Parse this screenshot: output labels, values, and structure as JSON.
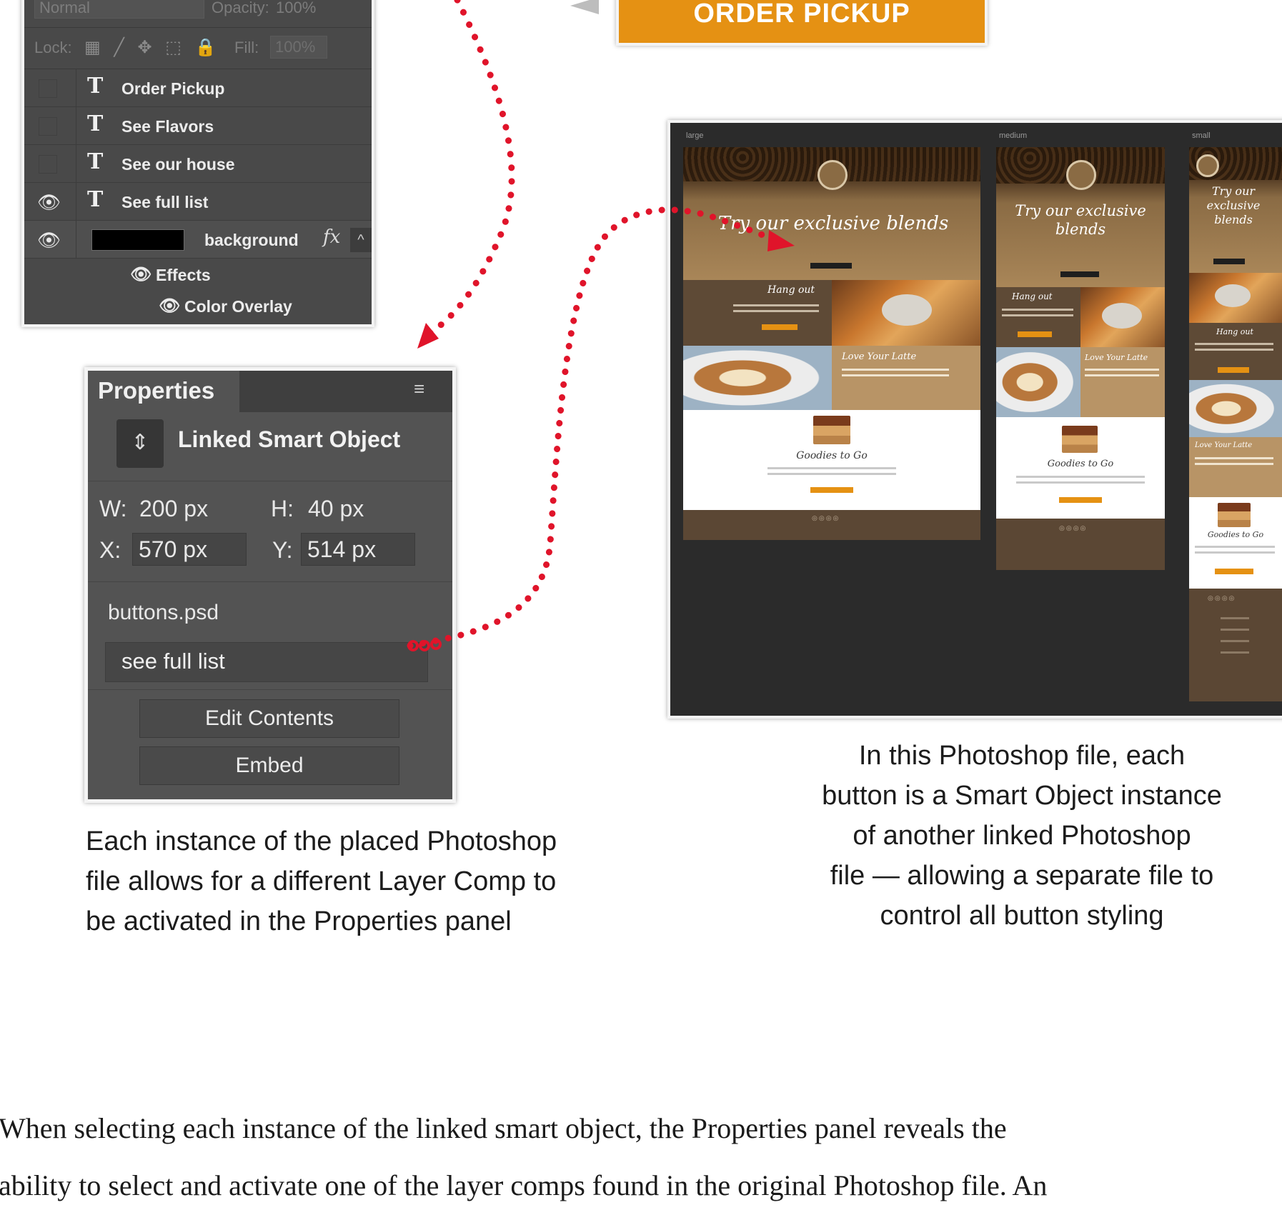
{
  "layers_panel": {
    "blend_mode": "Normal",
    "opacity_label": "Opacity:",
    "opacity_value": "100%",
    "lock_label": "Lock:",
    "lock_icons": "▦ ╱ ✥ ⬚ 🔒",
    "fill_label": "Fill:",
    "fill_value": "100%",
    "layers": [
      {
        "name": "Order Pickup",
        "visible": false
      },
      {
        "name": "See Flavors",
        "visible": false
      },
      {
        "name": "See our house",
        "visible": false
      },
      {
        "name": "See full list",
        "visible": true
      }
    ],
    "background_layer": {
      "name": "background",
      "fx": "fx",
      "caret": "^"
    },
    "effects_label": "Effects",
    "color_overlay_label": "Color Overlay",
    "eye_glyph": "👁",
    "type_glyph": "T"
  },
  "order_pickup_button": {
    "label": "ORDER PICKUP"
  },
  "properties_panel": {
    "tab_label": "Properties",
    "menu_icon": "≡",
    "object_icon": "⇕",
    "object_type": "Linked Smart Object",
    "w_label": "W:",
    "w_value": "200 px",
    "h_label": "H:",
    "h_value": "40 px",
    "x_label": "X:",
    "x_value": "570 px",
    "y_label": "Y:",
    "y_value": "514 px",
    "file_name": "buttons.psd",
    "layer_comp": "see full list",
    "edit_contents_label": "Edit Contents",
    "embed_label": "Embed"
  },
  "mockup": {
    "artboards": [
      {
        "label": "large",
        "headline": "Try our exclusive blends",
        "section_script": "Hang out",
        "cafe_script": "Love Your Latte",
        "to_go": "Goodies to Go"
      },
      {
        "label": "medium",
        "headline": "Try our exclusive blends",
        "section_script": "Hang out",
        "cafe_script": "Love Your Latte",
        "to_go": "Goodies to Go"
      },
      {
        "label": "small",
        "headline": "Try our exclusive blends",
        "section_script": "Hang out",
        "cafe_script": "Love Your Latte",
        "to_go": "Goodies to Go"
      }
    ],
    "footer_dots": "◎◎◎◎"
  },
  "captions": {
    "left": [
      "Each instance of the placed Photoshop",
      "file allows for a different Layer Comp to",
      "be activated in the Properties panel"
    ],
    "right": [
      "In this Photoshop file, each",
      "button is a Smart Object instance",
      "of another linked Photoshop",
      "file — allowing a separate file to",
      "control all button styling"
    ]
  },
  "body_text": [
    "When selecting each instance of the linked smart object, the Properties panel reveals the",
    "ability to select and activate one of the layer comps found in the original Photoshop file. An"
  ],
  "colors": {
    "accent_orange": "#e59113",
    "arrow_red": "#e0142a",
    "panel_gray": "#535353"
  }
}
